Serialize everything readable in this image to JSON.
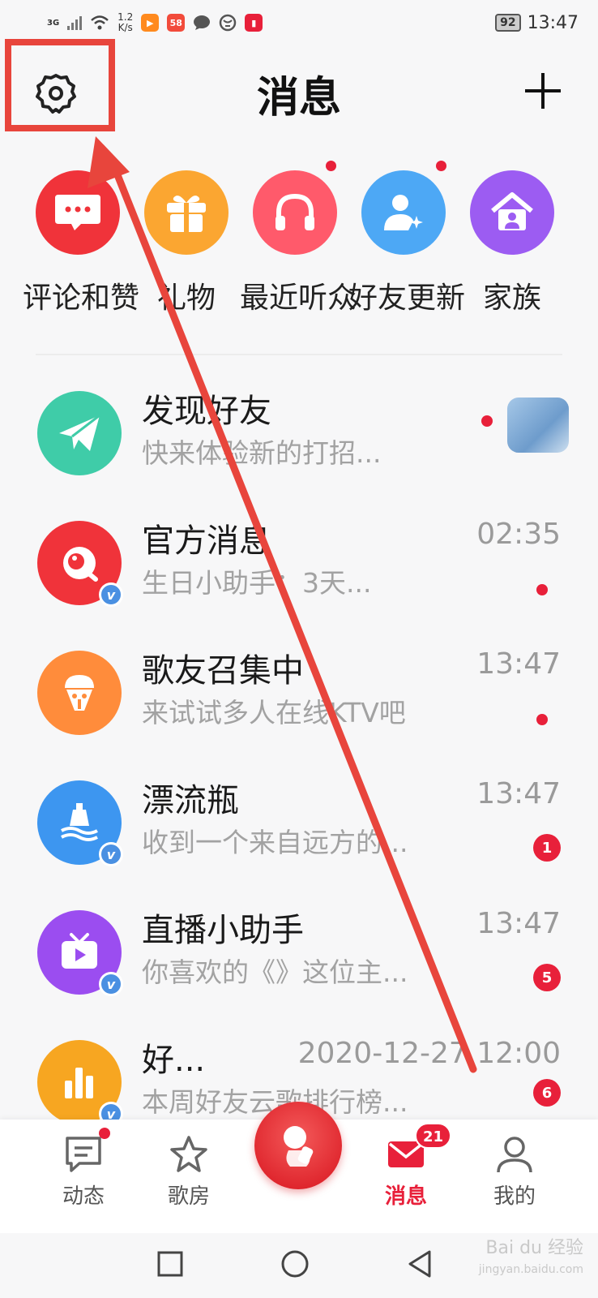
{
  "status_bar": {
    "network": "3G",
    "speed_value": "1.2",
    "speed_unit": "K/s",
    "app_icons": [
      "video-app-icon",
      "58-app-icon",
      "chat-app-icon",
      "globe-app-icon",
      "book-app-icon"
    ],
    "app_58_label": "58",
    "battery": "92",
    "time": "13:47"
  },
  "header": {
    "title": "消息",
    "settings_icon": "gear-icon",
    "add_icon": "plus-icon"
  },
  "categories": [
    {
      "label": "评论和赞",
      "icon": "comment-icon",
      "color": "#f0333a",
      "has_dot": false
    },
    {
      "label": "礼物",
      "icon": "gift-icon",
      "color": "#fba631",
      "has_dot": false
    },
    {
      "label": "最近听众",
      "icon": "headphone-icon",
      "color": "#ff5a6b",
      "has_dot": true
    },
    {
      "label": "好友更新",
      "icon": "friend-icon",
      "color": "#4da8f5",
      "has_dot": true
    },
    {
      "label": "家族",
      "icon": "home-icon",
      "color": "#9c5cf2",
      "has_dot": false
    }
  ],
  "messages": [
    {
      "title": "发现好友",
      "subtitle": "快来体验新的打招...",
      "time": "",
      "indicator": "dot",
      "icon": "paper-plane-icon",
      "color": "#3fcca8",
      "verified": false
    },
    {
      "title": "官方消息",
      "subtitle": "生日小助手：3天...",
      "time": "02:35",
      "indicator": "dot",
      "icon": "official-icon",
      "color": "#f0333a",
      "verified": true
    },
    {
      "title": "歌友召集中",
      "subtitle": "来试试多人在线KTV吧",
      "time": "13:47",
      "indicator": "dot",
      "icon": "ktv-icon",
      "color": "#ff8c3b",
      "verified": false
    },
    {
      "title": "漂流瓶",
      "subtitle": "收到一个来自远方的...",
      "time": "13:47",
      "indicator": "1",
      "icon": "bottle-icon",
      "color": "#3d96f0",
      "verified": true
    },
    {
      "title": "直播小助手",
      "subtitle": "你喜欢的《》这位主...",
      "time": "13:47",
      "indicator": "5",
      "icon": "live-tv-icon",
      "color": "#9b4df0",
      "verified": true
    },
    {
      "title": "好...",
      "subtitle": "本周好友云歌排行榜...",
      "time": "2020-12-27 12:00",
      "indicator": "6",
      "icon": "chart-icon",
      "color": "#f7a621",
      "verified": true
    }
  ],
  "verified_label": "v",
  "bottom_nav": {
    "items": [
      {
        "label": "动态",
        "icon": "feed-icon",
        "has_dot": true
      },
      {
        "label": "歌房",
        "icon": "star-icon",
        "has_dot": false
      },
      {
        "label": "消息",
        "icon": "mail-icon",
        "badge": "21",
        "active": true
      },
      {
        "label": "我的",
        "icon": "profile-icon",
        "has_dot": false
      }
    ],
    "center_icon": "sing-record-icon"
  },
  "system_nav": [
    "recent-apps-icon",
    "home-circle-icon",
    "back-triangle-icon"
  ],
  "watermark": {
    "line1": "Bai du 经验",
    "line2": "jingyan.baidu.com"
  },
  "annotation": {
    "color": "#e8453c"
  }
}
